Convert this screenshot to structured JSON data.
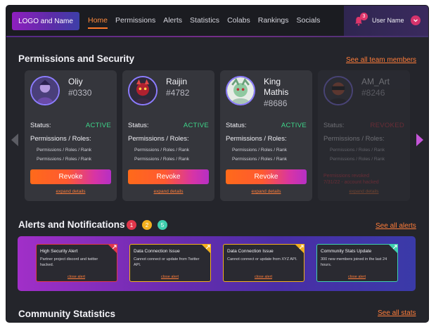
{
  "nav": {
    "logo": "LOGO and Name",
    "links": [
      "Home",
      "Permissions",
      "Alerts",
      "Statistics",
      "Colabs",
      "Rankings",
      "Socials"
    ],
    "notification_count": "3",
    "user_name": "User Name"
  },
  "permissions": {
    "title": "Permissions and Security",
    "see_all": "See all team members",
    "status_label": "Status:",
    "roles_label": "Permissions / Roles:",
    "role_line": "Permissions / Roles / Rank",
    "revoke_label": "Revoke",
    "expand_label": "expand details",
    "members": [
      {
        "name": "Oliy",
        "id": "#0330",
        "status": "ACTIVE"
      },
      {
        "name": "Raijin",
        "id": "#4782",
        "status": "ACTIVE"
      },
      {
        "name_line1": "King",
        "name_line2": "Mathis",
        "id": "#8686",
        "status": "ACTIVE"
      },
      {
        "name": "AM_Art",
        "id": "#8246",
        "status": "REVOKED",
        "revoked_line1": "Permissions revoked",
        "revoked_line2": "7/31/22 - account hacked",
        "revoked_link": "expand details"
      }
    ]
  },
  "alerts": {
    "title": "Alerts and Notifications",
    "see_all": "See all alerts",
    "counts": [
      "1",
      "2",
      "5"
    ],
    "close_label": "close alert",
    "items": [
      {
        "title": "High Security Alert",
        "desc": "Partner project discord and twitter hacked.",
        "color": "#e0364a"
      },
      {
        "title": "Data Connection Issue",
        "desc": "Cannot connect or update from Twitter API.",
        "color": "#f2b01e"
      },
      {
        "title": "Data Connection Issue",
        "desc": "Cannot connect or update from XYZ API.",
        "color": "#f2b01e"
      },
      {
        "title": "Community Stats Update",
        "desc": "300 new members joined in the last 24 hours.",
        "color": "#3fcfae"
      }
    ]
  },
  "stats": {
    "title": "Community Statistics",
    "see_all": "See all stats"
  }
}
